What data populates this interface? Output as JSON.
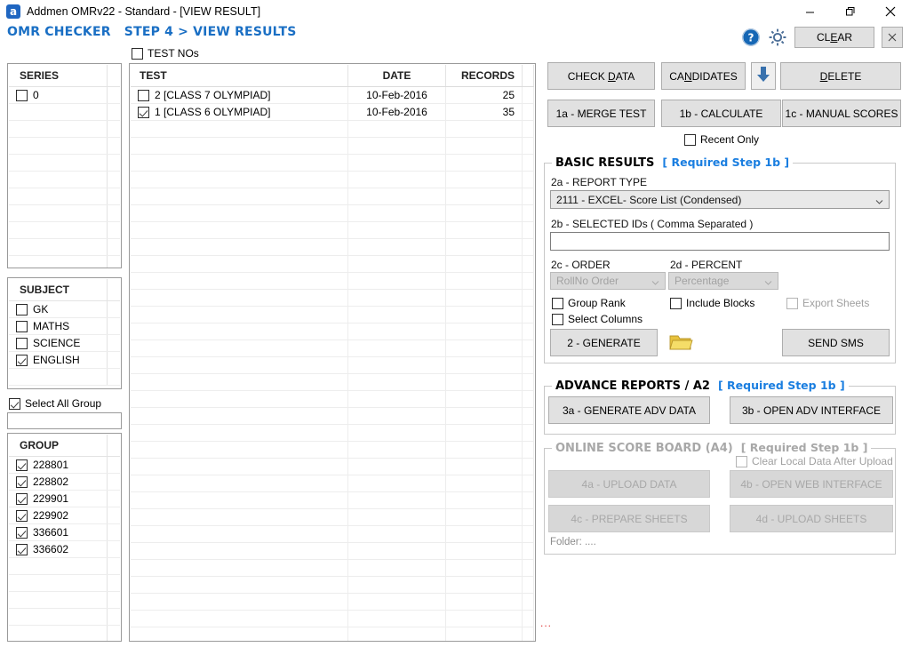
{
  "window": {
    "title": "Addmen OMRv22 - Standard - [VIEW RESULT]",
    "app_icon": "addmen-a-icon",
    "minimize": "—",
    "restore": "❐",
    "close": "✕"
  },
  "header": {
    "app_name": "OMR CHECKER",
    "step": "STEP 4 > VIEW RESULTS",
    "help_icon": "help-circle-icon",
    "settings_icon": "gear-icon",
    "clear_label": "CLEAR",
    "close_label": "✕",
    "accent_color": "#1a6fc4"
  },
  "series_panel": {
    "header": "SERIES",
    "rows": [
      {
        "label": "0",
        "checked": false
      }
    ],
    "empty_rows": 10
  },
  "subject_panel": {
    "header": "SUBJECT",
    "rows": [
      {
        "label": "GK",
        "checked": false
      },
      {
        "label": "MATHS",
        "checked": false
      },
      {
        "label": "SCIENCE",
        "checked": false
      },
      {
        "label": "ENGLISH",
        "checked": true
      }
    ],
    "empty_rows": 1
  },
  "select_all_group": {
    "label": "Select All Group",
    "checked": true
  },
  "group_filter": {
    "value": "",
    "placeholder": ""
  },
  "group_panel": {
    "header": "GROUP",
    "rows": [
      {
        "label": "228801",
        "checked": true
      },
      {
        "label": "228802",
        "checked": true
      },
      {
        "label": "229901",
        "checked": true
      },
      {
        "label": "229902",
        "checked": true
      },
      {
        "label": "336601",
        "checked": true
      },
      {
        "label": "336602",
        "checked": true
      }
    ],
    "empty_rows": 5
  },
  "test_nos": {
    "label": "TEST NOs",
    "checked": false
  },
  "test_table": {
    "columns": [
      "TEST",
      "DATE",
      "RECORDS"
    ],
    "rows": [
      {
        "checked": false,
        "test": "2 [CLASS 7 OLYMPIAD]",
        "date": "10-Feb-2016",
        "records": "25"
      },
      {
        "checked": true,
        "test": "1 [CLASS 6 OLYMPIAD]",
        "date": "10-Feb-2016",
        "records": "35"
      }
    ],
    "empty_rows": 31
  },
  "actions": {
    "check_data": "CHECK DATA",
    "candidates": "CANDIDATES",
    "download_icon": "down-arrow-icon",
    "delete": "DELETE",
    "merge_test": "1a - MERGE TEST",
    "calculate": "1b - CALCULATE",
    "manual_scores": "1c - MANUAL SCORES",
    "recent_only": {
      "label": "Recent Only",
      "checked": false
    }
  },
  "basic_results": {
    "title": "BASIC RESULTS",
    "required": "[ Required Step 1b ]",
    "report_type_label": "2a - REPORT TYPE",
    "report_type_value": "2111 - EXCEL- Score List (Condensed)",
    "selected_ids_label": "2b - SELECTED IDs ( Comma Separated )",
    "selected_ids_value": "",
    "order_label": "2c - ORDER",
    "order_value": "RollNo Order",
    "percent_label": "2d - PERCENT",
    "percent_value": "Percentage",
    "group_rank": {
      "label": "Group Rank",
      "checked": false
    },
    "select_columns": {
      "label": "Select Columns",
      "checked": false
    },
    "include_blocks": {
      "label": "Include Blocks",
      "checked": false
    },
    "export_sheets": {
      "label": "Export Sheets",
      "checked": false
    },
    "generate": "2 - GENERATE",
    "folder_icon": "folder-icon",
    "send_sms": "SEND SMS"
  },
  "advance_reports": {
    "title": "ADVANCE REPORTS / A2",
    "required": "[ Required Step 1b ]",
    "generate_adv_data": "3a - GENERATE ADV DATA",
    "open_adv_interface": "3b - OPEN ADV INTERFACE"
  },
  "online_score_board": {
    "title": "ONLINE SCORE BOARD (A4)",
    "required": "[ Required Step 1b ]",
    "clear_local": {
      "label": "Clear Local Data After Upload",
      "checked": false
    },
    "upload_data": "4a - UPLOAD DATA",
    "open_web_interface": "4b - OPEN WEB INTERFACE",
    "prepare_sheets": "4c - PREPARE SHEETS",
    "upload_sheets": "4d - UPLOAD SHEETS",
    "folder_note": "Folder: ...."
  },
  "status_dots": "..."
}
